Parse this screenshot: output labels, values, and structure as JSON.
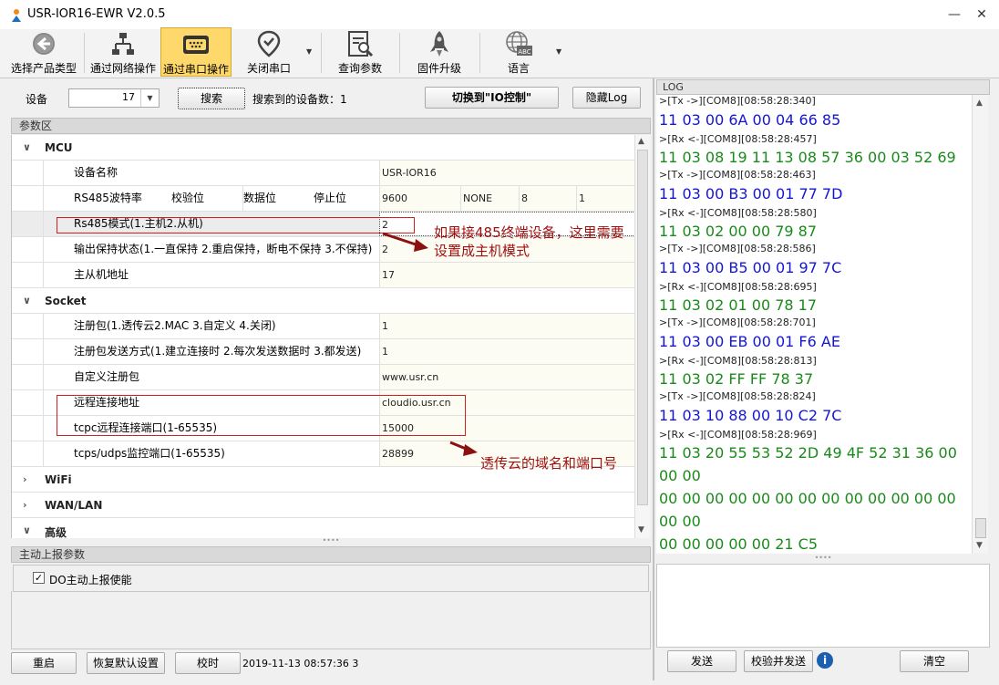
{
  "window": {
    "title": "USR-IOR16-EWR V2.0.5"
  },
  "toolbar": {
    "select_product": "选择产品类型",
    "network_op": "通过网络操作",
    "serial_op": "通过串口操作",
    "close_serial": "关闭串口",
    "query_params": "查询参数",
    "firmware_upgrade": "固件升级",
    "language": "语言"
  },
  "device_bar": {
    "device_label": "设备",
    "device_value": "17",
    "search_label": "搜索",
    "found_text": "搜索到的设备数：1",
    "switch_label": "切换到\"IO控制\"",
    "hide_log_label": "隐藏Log"
  },
  "param_area": {
    "title": "参数区"
  },
  "groups": {
    "mcu": "MCU",
    "socket": "Socket",
    "wifi": "WiFi",
    "wanlan": "WAN/LAN",
    "advanced": "高级"
  },
  "mcu": {
    "device_name": {
      "label": "设备名称",
      "value": "USR-IOR16"
    },
    "rs485": {
      "baud": "RS485波特率",
      "parity": "校验位",
      "databits": "数据位",
      "stopbits": "停止位",
      "baud_v": "9600",
      "parity_v": "NONE",
      "databits_v": "8",
      "stopbits_v": "1"
    },
    "rs485_mode": {
      "label": "Rs485模式(1.主机2.从机)",
      "value": "2"
    },
    "output_hold": {
      "label": "输出保持状态(1.一直保持 2.重启保持，断电不保持 3.不保持)",
      "value": "2"
    },
    "slave_addr": {
      "label": "主从机地址",
      "value": "17"
    }
  },
  "socket": {
    "reg_pkg": {
      "label": "注册包(1.透传云2.MAC 3.自定义 4.关闭)",
      "value": "1"
    },
    "reg_send": {
      "label": "注册包发送方式(1.建立连接时 2.每次发送数据时 3.都发送)",
      "value": "1"
    },
    "custom_reg": {
      "label": "自定义注册包",
      "value": "www.usr.cn"
    },
    "remote_addr": {
      "label": "远程连接地址",
      "value": "cloudio.usr.cn"
    },
    "remote_port": {
      "label": "tcpc远程连接端口(1-65535)",
      "value": "15000"
    },
    "monitor_port": {
      "label": "tcps/udps监控端口(1-65535)",
      "value": "28899"
    }
  },
  "annotations": {
    "rs485_note_1": "如果接485终端设备，这里需要",
    "rs485_note_2": "设置成主机模式",
    "cloud_note": "透传云的域名和端口号"
  },
  "report": {
    "title": "主动上报参数",
    "do_enable": "DO主动上报使能",
    "do_checked": true
  },
  "bottom": {
    "restart": "重启",
    "restore": "恢复默认设置",
    "time_sync": "校时",
    "datetime": "2019-11-13 08:57:36 3"
  },
  "log": {
    "title": "LOG",
    "entries": [
      {
        "type": "meta",
        "text": ">[Tx ->][COM8][08:58:28:340]"
      },
      {
        "type": "tx",
        "text": "11 03 00 6A 00 04 66 85"
      },
      {
        "type": "meta",
        "text": ">[Rx <-][COM8][08:58:28:457]"
      },
      {
        "type": "rx",
        "text": "11 03 08 19 11 13 08 57 36 00 03 52 69"
      },
      {
        "type": "meta",
        "text": ">[Tx ->][COM8][08:58:28:463]"
      },
      {
        "type": "tx",
        "text": "11 03 00 B3 00 01 77 7D"
      },
      {
        "type": "meta",
        "text": ">[Rx <-][COM8][08:58:28:580]"
      },
      {
        "type": "rx",
        "text": "11 03 02 00 00 79 87"
      },
      {
        "type": "meta",
        "text": ">[Tx ->][COM8][08:58:28:586]"
      },
      {
        "type": "tx",
        "text": "11 03 00 B5 00 01 97 7C"
      },
      {
        "type": "meta",
        "text": ">[Rx <-][COM8][08:58:28:695]"
      },
      {
        "type": "rx",
        "text": "11 03 02 01 00 78 17"
      },
      {
        "type": "meta",
        "text": ">[Tx ->][COM8][08:58:28:701]"
      },
      {
        "type": "tx",
        "text": "11 03 00 EB 00 01 F6 AE"
      },
      {
        "type": "meta",
        "text": ">[Rx <-][COM8][08:58:28:813]"
      },
      {
        "type": "rx",
        "text": "11 03 02 FF FF 78 37"
      },
      {
        "type": "meta",
        "text": ">[Tx ->][COM8][08:58:28:824]"
      },
      {
        "type": "tx",
        "text": "11 03 10 88 00 10 C2 7C"
      },
      {
        "type": "meta",
        "text": ">[Rx <-][COM8][08:58:28:969]"
      },
      {
        "type": "rx",
        "text": "11 03 20 55 53 52 2D 49 4F 52 31 36 00 00 00"
      },
      {
        "type": "rx",
        "text": "00 00 00 00 00 00 00 00 00 00 00 00 00 00 00"
      },
      {
        "type": "rx",
        "text": "00 00 00 00 00 21 C5"
      }
    ],
    "send": "发送",
    "check_send": "校验并发送",
    "clear": "清空"
  }
}
